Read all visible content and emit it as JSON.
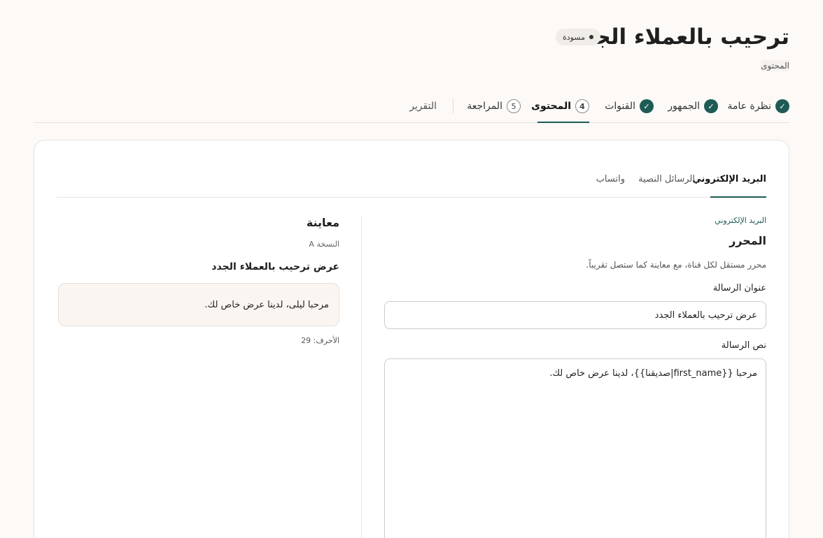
{
  "header": {
    "title": "ترحيب بالعملاء الجدد",
    "status_badge": "مسودة",
    "breadcrumb": "المحتوى"
  },
  "stepper": {
    "steps": [
      {
        "label": "نظرة عامة",
        "state": "done",
        "marker": "✓"
      },
      {
        "label": "الجمهور",
        "state": "done",
        "marker": "✓"
      },
      {
        "label": "القنوات",
        "state": "done",
        "marker": "✓"
      },
      {
        "label": "المحتوى",
        "state": "active",
        "marker": "4"
      },
      {
        "label": "المراجعة",
        "state": "todo",
        "marker": "5"
      },
      {
        "label": "التقرير",
        "state": "todo",
        "marker": ""
      }
    ]
  },
  "channels": {
    "tabs": [
      "البريد الإلكتروني",
      "الرسائل النصية",
      "واتساب"
    ],
    "active": "البريد الإلكتروني"
  },
  "editor": {
    "eyebrow": "البريد الإلكتروني",
    "title": "المحرر",
    "description": "محرر مستقل لكل قناة، مع معاينة كما ستصل تقريباً.",
    "subject_label": "عنوان الرسالة",
    "subject_value": "عرض ترحيب بالعملاء الجدد",
    "body_label": "نص الرسالة",
    "body_value": "مرحبا {{first_name|صديقنا}}، لدينا عرض خاص لك."
  },
  "preview": {
    "title": "معاينة",
    "variant": "النسخة A",
    "subject": "عرض ترحيب بالعملاء الجدد",
    "body": "مرحبا ليلى، لدينا عرض خاص لك.",
    "char_count": "الأحرف: 29"
  },
  "colors": {
    "accent": "#1f5b55",
    "background": "#fcf9f7"
  }
}
